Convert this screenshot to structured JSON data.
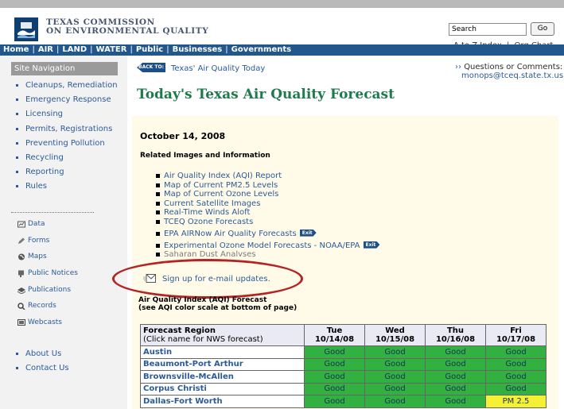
{
  "header": {
    "agency_line1": "Texas Commission",
    "agency_line2": "on Environmental Quality",
    "search_value": "Search",
    "go_label": "Go",
    "a_to_z": "A to Z Index",
    "link_separator": "|",
    "org_chart": "Org Chart"
  },
  "nav": {
    "items": [
      "Home",
      "AIR",
      "LAND",
      "WATER",
      "Public",
      "Businesses",
      "Governments"
    ],
    "separator": "|"
  },
  "sidebar": {
    "title": "Site Navigation",
    "items": [
      "Cleanups, Remediation",
      "Emergency Response",
      "Licensing",
      "Permits, Registrations",
      "Preventing Pollution",
      "Recycling",
      "Reporting",
      "Rules"
    ],
    "icon_items": [
      {
        "label": "Data",
        "icon": "data-icon"
      },
      {
        "label": "Forms",
        "icon": "pencil-icon"
      },
      {
        "label": "Maps",
        "icon": "globe-icon"
      },
      {
        "label": "Public Notices",
        "icon": "notice-icon"
      },
      {
        "label": "Publications",
        "icon": "books-icon"
      },
      {
        "label": "Records",
        "icon": "magnifier-icon"
      },
      {
        "label": "Webcasts",
        "icon": "monitor-icon"
      }
    ],
    "bottom_items": [
      "About Us",
      "Contact Us"
    ]
  },
  "content": {
    "back_badge": "BACK TO:",
    "back_link": "Texas' Air Quality Today",
    "questions_arrow": "››",
    "questions_label": "Questions or Comments:",
    "questions_email": "monops@tceq.state.tx.us",
    "title": "Today's Texas Air Quality Forecast",
    "date": "October 14, 2008",
    "related_heading": "Related Images and Information",
    "links": [
      {
        "label": "Air Quality Index (AQI) Report",
        "exit": ""
      },
      {
        "label": "Map of Current PM2.5 Levels",
        "exit": ""
      },
      {
        "label": "Map of Current Ozone Levels",
        "exit": ""
      },
      {
        "label": "Current Satellite Images",
        "exit": ""
      },
      {
        "label": "Real-Time Winds Aloft",
        "exit": ""
      },
      {
        "label": "TCEQ Ozone Forecasts",
        "exit": ""
      },
      {
        "label": "EPA AIRNow Air Quality Forecasts",
        "exit": "Exit"
      },
      {
        "label": "Experimental Ozone Model Forecasts - NOAA/EPA",
        "exit": "Exit"
      },
      {
        "label": "Saharan Dust Analyses",
        "exit": ""
      }
    ],
    "signup": "Sign up for e-mail updates.",
    "aqi_heading_line1": "Air Quality Index (AQI) Forecast",
    "aqi_heading_line2": "(see AQI color scale at bottom of page)"
  },
  "forecast_table": {
    "region_header": "Forecast Region",
    "region_subheader": "(Click name for NWS forecast)",
    "days": [
      {
        "day": "Tue",
        "date": "10/14/08"
      },
      {
        "day": "Wed",
        "date": "10/15/08"
      },
      {
        "day": "Thu",
        "date": "10/16/08"
      },
      {
        "day": "Fri",
        "date": "10/17/08"
      }
    ],
    "rows": [
      {
        "region": "Austin",
        "values": [
          "Good",
          "Good",
          "Good",
          "Good"
        ]
      },
      {
        "region": "Beaumont-Port Arthur",
        "values": [
          "Good",
          "Good",
          "Good",
          "Good"
        ]
      },
      {
        "region": "Brownsville-McAllen",
        "values": [
          "Good",
          "Good",
          "Good",
          "Good"
        ]
      },
      {
        "region": "Corpus Christi",
        "values": [
          "Good",
          "Good",
          "Good",
          "Good"
        ]
      },
      {
        "region": "Dallas-Fort Worth",
        "values": [
          "Good",
          "Good",
          "Good",
          "PM 2.5"
        ]
      }
    ],
    "colors": {
      "good": "#33b140",
      "moderate": "#f4f135"
    }
  },
  "colors": {
    "nav_bar": "#22578e",
    "title_green": "#1f7a4c",
    "link_blue": "#2b5a9a",
    "highlight_red": "#b32424"
  }
}
